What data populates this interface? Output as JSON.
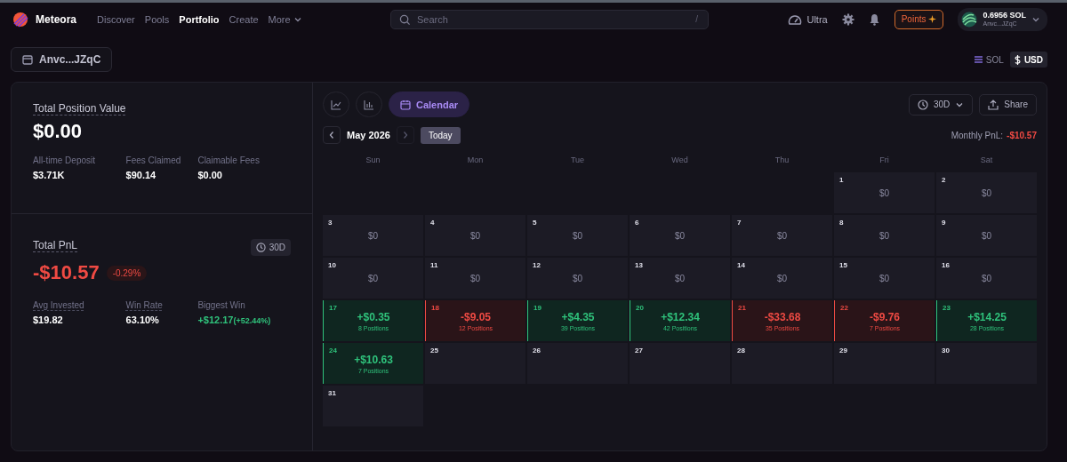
{
  "nav": {
    "brand": "Meteora",
    "links": [
      {
        "label": "Discover",
        "selected": false
      },
      {
        "label": "Pools",
        "selected": false
      },
      {
        "label": "Portfolio",
        "selected": true
      },
      {
        "label": "Create",
        "selected": false
      },
      {
        "label": "More",
        "selected": false
      }
    ],
    "search": {
      "placeholder": "Search",
      "shortcut": "/"
    },
    "ultra": "Ultra",
    "points": "Points",
    "wallet": {
      "balance": "0.6956 SOL",
      "address": "Anvc...JZqC"
    }
  },
  "wallet_button": "Anvc...JZqC",
  "currency_toggle": [
    {
      "label": "SOL",
      "selected": false
    },
    {
      "label": "USD",
      "selected": true
    }
  ],
  "summary": {
    "title": "Total Position Value",
    "value": "$0.00",
    "stats": [
      {
        "label": "All-time Deposit",
        "value": "$3.71K"
      },
      {
        "label": "Fees Claimed",
        "value": "$90.14"
      },
      {
        "label": "Claimable Fees",
        "value": "$0.00"
      }
    ]
  },
  "pnl": {
    "title": "Total PnL",
    "period": "30D",
    "value": "-$10.57",
    "change": "-0.29%",
    "stats": [
      {
        "label": "Avg Invested",
        "value": "$19.82",
        "kind": "plain"
      },
      {
        "label": "Win Rate",
        "value": "63.10%",
        "kind": "plain"
      },
      {
        "label": "Biggest Win",
        "value": "+$12.17",
        "detail": "(+52.44%)",
        "kind": "gain"
      }
    ]
  },
  "calendar": {
    "views": [
      {
        "kind": "line",
        "selected": false
      },
      {
        "kind": "bar",
        "selected": false
      },
      {
        "kind": "calendar",
        "label": "Calendar",
        "selected": true
      }
    ],
    "period": "30D",
    "share": "Share",
    "month": "May 2026",
    "today": "Today",
    "monthly_label": "Monthly PnL:",
    "monthly_value": "-$10.57",
    "weekdays": [
      "Sun",
      "Mon",
      "Tue",
      "Wed",
      "Thu",
      "Fri",
      "Sat"
    ],
    "days": [
      {
        "kind": "blank"
      },
      {
        "kind": "blank"
      },
      {
        "kind": "blank"
      },
      {
        "kind": "blank"
      },
      {
        "kind": "blank"
      },
      {
        "kind": "zero",
        "date": "1",
        "amount": "$0"
      },
      {
        "kind": "zero",
        "date": "2",
        "amount": "$0"
      },
      {
        "kind": "zero",
        "date": "3",
        "amount": "$0"
      },
      {
        "kind": "zero",
        "date": "4",
        "amount": "$0"
      },
      {
        "kind": "zero",
        "date": "5",
        "amount": "$0"
      },
      {
        "kind": "zero",
        "date": "6",
        "amount": "$0"
      },
      {
        "kind": "zero",
        "date": "7",
        "amount": "$0"
      },
      {
        "kind": "zero",
        "date": "8",
        "amount": "$0"
      },
      {
        "kind": "zero",
        "date": "9",
        "amount": "$0"
      },
      {
        "kind": "zero",
        "date": "10",
        "amount": "$0"
      },
      {
        "kind": "zero",
        "date": "11",
        "amount": "$0"
      },
      {
        "kind": "zero",
        "date": "12",
        "amount": "$0"
      },
      {
        "kind": "zero",
        "date": "13",
        "amount": "$0"
      },
      {
        "kind": "zero",
        "date": "14",
        "amount": "$0"
      },
      {
        "kind": "zero",
        "date": "15",
        "amount": "$0"
      },
      {
        "kind": "zero",
        "date": "16",
        "amount": "$0"
      },
      {
        "kind": "gain",
        "date": "17",
        "amount": "+$0.35",
        "positions": "8 Positions"
      },
      {
        "kind": "loss",
        "date": "18",
        "amount": "-$9.05",
        "positions": "12 Positions"
      },
      {
        "kind": "gain",
        "date": "19",
        "amount": "+$4.35",
        "positions": "39 Positions"
      },
      {
        "kind": "gain",
        "date": "20",
        "amount": "+$12.34",
        "positions": "42 Positions"
      },
      {
        "kind": "loss",
        "date": "21",
        "amount": "-$33.68",
        "positions": "35 Positions"
      },
      {
        "kind": "loss",
        "date": "22",
        "amount": "-$9.76",
        "positions": "7 Positions"
      },
      {
        "kind": "gain",
        "date": "23",
        "amount": "+$14.25",
        "positions": "28 Positions"
      },
      {
        "kind": "gain",
        "date": "24",
        "amount": "+$10.63",
        "positions": "7 Positions"
      },
      {
        "kind": "future",
        "date": "25"
      },
      {
        "kind": "future",
        "date": "26"
      },
      {
        "kind": "future",
        "date": "27"
      },
      {
        "kind": "future",
        "date": "28"
      },
      {
        "kind": "future",
        "date": "29"
      },
      {
        "kind": "future",
        "date": "30"
      },
      {
        "kind": "future",
        "date": "31"
      }
    ]
  }
}
